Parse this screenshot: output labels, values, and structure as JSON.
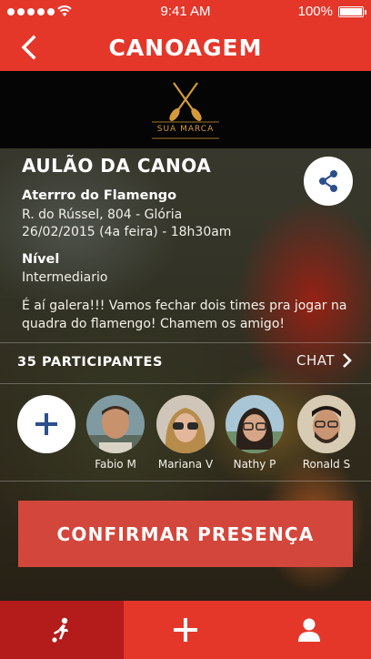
{
  "status_bar": {
    "time": "9:41 AM",
    "battery_percent": "100%",
    "signal_dots": 5
  },
  "nav": {
    "title": "CANOAGEM",
    "back_icon": "chevron-left-icon"
  },
  "logo": {
    "brand": "SUA MARCA",
    "brand_color": "#d49a3a"
  },
  "event": {
    "title": "AULÃO DA CANOA",
    "place_name": "Aterrro do Flamengo",
    "address": "R. do Rússel, 804 - Glória",
    "datetime": "26/02/2015 (4a feira) - 18h30am",
    "level_label": "Nível",
    "level_value": "Intermediario",
    "description": "É aí galera!!! Vamos fechar dois times pra jogar na quadra do flamengo! Chamem os amigo!"
  },
  "participants": {
    "count_label": "35 PARTICIPANTES",
    "chat_label": "CHAT",
    "people": [
      {
        "name": "Fabio M"
      },
      {
        "name": "Mariana V"
      },
      {
        "name": "Nathy P"
      },
      {
        "name": "Ronald S"
      }
    ]
  },
  "actions": {
    "confirm_label": "CONFIRMAR PRESENÇA"
  },
  "tabbar": {
    "items": [
      {
        "icon": "soccer-player-icon",
        "active": true
      },
      {
        "icon": "plus-icon",
        "active": false
      },
      {
        "icon": "user-icon",
        "active": false
      }
    ]
  },
  "colors": {
    "primary": "#e4372a",
    "tab_active": "#b31c1b",
    "confirm_button": "#d3463b",
    "share_icon": "#2d4f8c"
  }
}
